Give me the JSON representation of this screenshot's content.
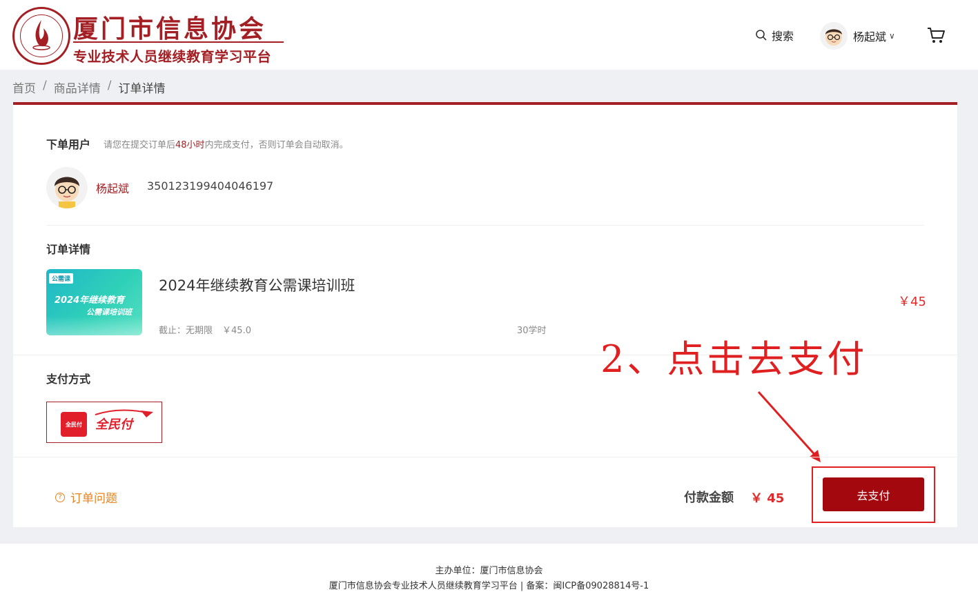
{
  "header": {
    "logo_title": "厦门市信息协会",
    "logo_subtitle": "专业技术人员继续教育学习平台",
    "search_label": "搜索",
    "user_name": "杨起斌",
    "icons": [
      "search-icon",
      "avatar",
      "chevron-down-icon",
      "cart-icon"
    ]
  },
  "breadcrumb": {
    "items": [
      "首页",
      "商品详情",
      "订单详情"
    ],
    "separator": "/"
  },
  "buyer": {
    "section_title": "下单用户",
    "hint_prefix": "请您在提交订单后",
    "hint_highlight": "48小时",
    "hint_suffix": "内完成支付，否则订单会自动取消。",
    "name": "杨起斌",
    "id_number": "350123199404046197"
  },
  "order": {
    "section_title": "订单详情",
    "course": {
      "image_tag": "公需课",
      "image_line1": "2024年继续教育",
      "image_line2": "公需课培训班",
      "title": "2024年继续教育公需课培训班",
      "deadline_label": "截止：",
      "deadline_value": "无期限",
      "unit_price": "￥45.0",
      "hours": "30学时",
      "price": "￥45"
    }
  },
  "payment": {
    "section_title": "支付方式",
    "method_icon_text": "全民付",
    "method_name": "全民付"
  },
  "annotation": {
    "text": "2、点击去支付",
    "color": "#e02020"
  },
  "footer_bar": {
    "order_issue_label": "订单问题",
    "pay_total_label": "付款金额",
    "pay_total_value": "￥ 45",
    "pay_button_label": "去支付"
  },
  "footer": {
    "host": "主办单位：厦门市信息协会",
    "icp": "厦门市信息协会专业技术人员继续教育学习平台 | 备案：闽ICP备09028814号-1"
  },
  "colors": {
    "brand": "#a31f24",
    "price": "#e02a2a",
    "button": "#a4080f",
    "link_orange": "#e8821e"
  }
}
